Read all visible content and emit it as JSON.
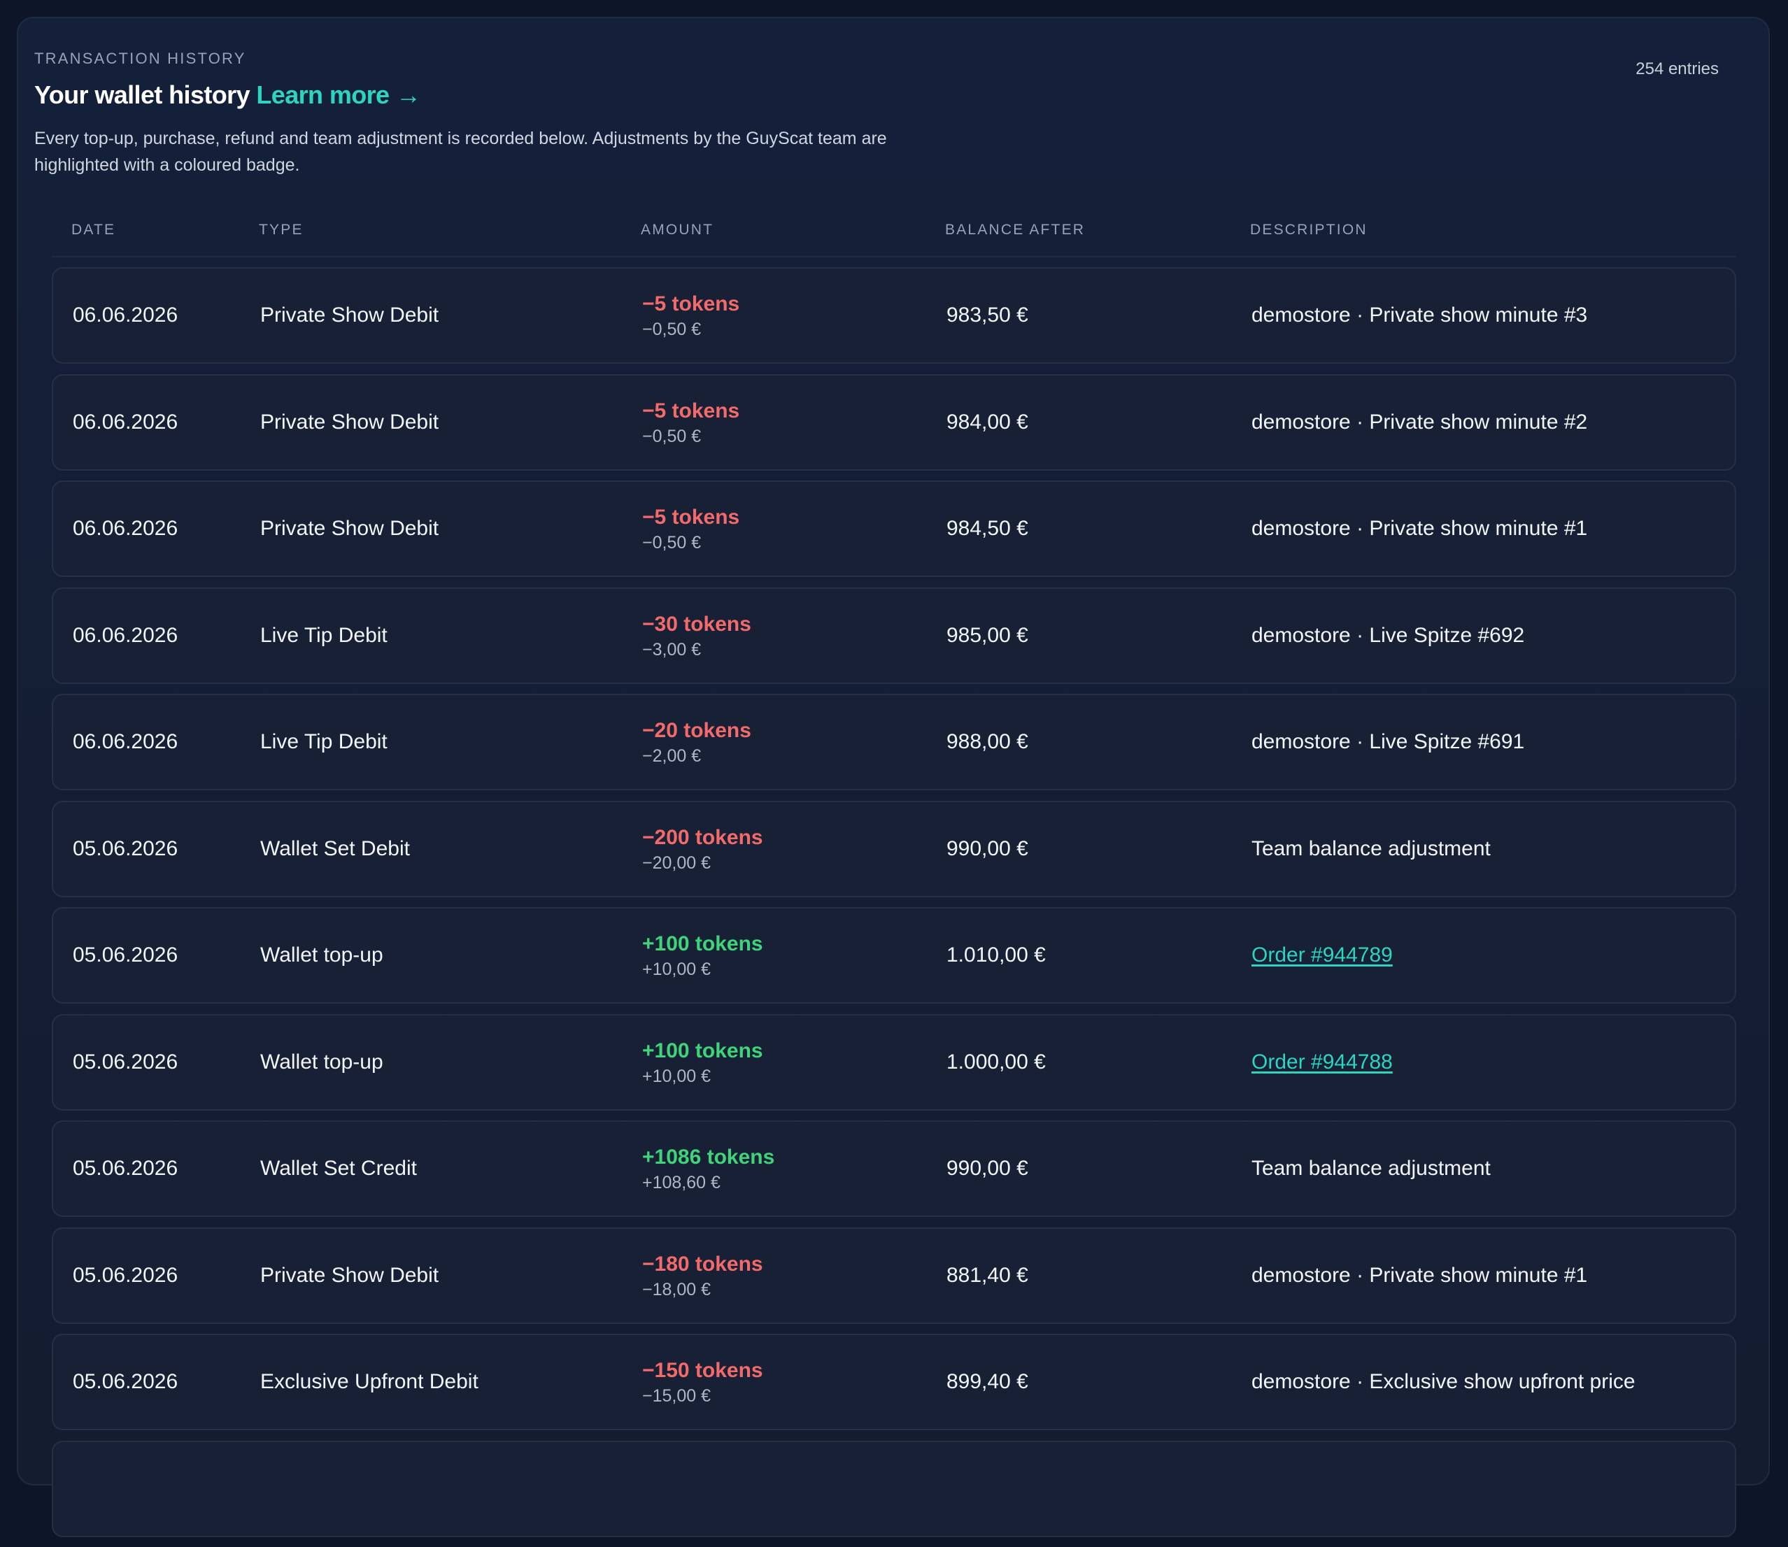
{
  "header": {
    "eyebrow": "TRANSACTION HISTORY",
    "title": "Your wallet history",
    "learn_more": "Learn more →",
    "description": "Every top-up, purchase, refund and team adjustment is recorded below. Adjustments by the GuyScat team are highlighted with a coloured badge.",
    "entries": "254 entries"
  },
  "table": {
    "columns": [
      "DATE",
      "TYPE",
      "AMOUNT",
      "BALANCE AFTER",
      "DESCRIPTION"
    ],
    "rows": [
      {
        "date": "06.06.2026",
        "type": "Private Show Debit",
        "tokens": "−5 tokens",
        "eur": "−0,50 €",
        "sign": "neg",
        "balance": "983,50 €",
        "description": "demostore · Private show minute #3",
        "is_link": false
      },
      {
        "date": "06.06.2026",
        "type": "Private Show Debit",
        "tokens": "−5 tokens",
        "eur": "−0,50 €",
        "sign": "neg",
        "balance": "984,00 €",
        "description": "demostore · Private show minute #2",
        "is_link": false
      },
      {
        "date": "06.06.2026",
        "type": "Private Show Debit",
        "tokens": "−5 tokens",
        "eur": "−0,50 €",
        "sign": "neg",
        "balance": "984,50 €",
        "description": "demostore · Private show minute #1",
        "is_link": false
      },
      {
        "date": "06.06.2026",
        "type": "Live Tip Debit",
        "tokens": "−30 tokens",
        "eur": "−3,00 €",
        "sign": "neg",
        "balance": "985,00 €",
        "description": "demostore · Live Spitze #692",
        "is_link": false
      },
      {
        "date": "06.06.2026",
        "type": "Live Tip Debit",
        "tokens": "−20 tokens",
        "eur": "−2,00 €",
        "sign": "neg",
        "balance": "988,00 €",
        "description": "demostore · Live Spitze #691",
        "is_link": false
      },
      {
        "date": "05.06.2026",
        "type": "Wallet Set Debit",
        "tokens": "−200 tokens",
        "eur": "−20,00 €",
        "sign": "neg",
        "balance": "990,00 €",
        "description": "Team balance adjustment",
        "is_link": false
      },
      {
        "date": "05.06.2026",
        "type": "Wallet top-up",
        "tokens": "+100 tokens",
        "eur": "+10,00 €",
        "sign": "pos",
        "balance": "1.010,00 €",
        "description": "Order #944789",
        "is_link": true
      },
      {
        "date": "05.06.2026",
        "type": "Wallet top-up",
        "tokens": "+100 tokens",
        "eur": "+10,00 €",
        "sign": "pos",
        "balance": "1.000,00 €",
        "description": "Order #944788",
        "is_link": true
      },
      {
        "date": "05.06.2026",
        "type": "Wallet Set Credit",
        "tokens": "+1086 tokens",
        "eur": "+108,60 €",
        "sign": "pos",
        "balance": "990,00 €",
        "description": "Team balance adjustment",
        "is_link": false
      },
      {
        "date": "05.06.2026",
        "type": "Private Show Debit",
        "tokens": "−180 tokens",
        "eur": "−18,00 €",
        "sign": "neg",
        "balance": "881,40 €",
        "description": "demostore · Private show minute #1",
        "is_link": false
      },
      {
        "date": "05.06.2026",
        "type": "Exclusive Upfront Debit",
        "tokens": "−150 tokens",
        "eur": "−15,00 €",
        "sign": "neg",
        "balance": "899,40 €",
        "description": "demostore · Exclusive show upfront price",
        "is_link": false
      },
      {
        "date": "",
        "type": "",
        "tokens": "",
        "eur": "",
        "sign": "neg",
        "balance": "",
        "description": "",
        "is_link": false
      }
    ]
  },
  "colors": {
    "negative": "#f26a6a",
    "positive": "#3fd47a",
    "accent": "#2dd4bf"
  }
}
